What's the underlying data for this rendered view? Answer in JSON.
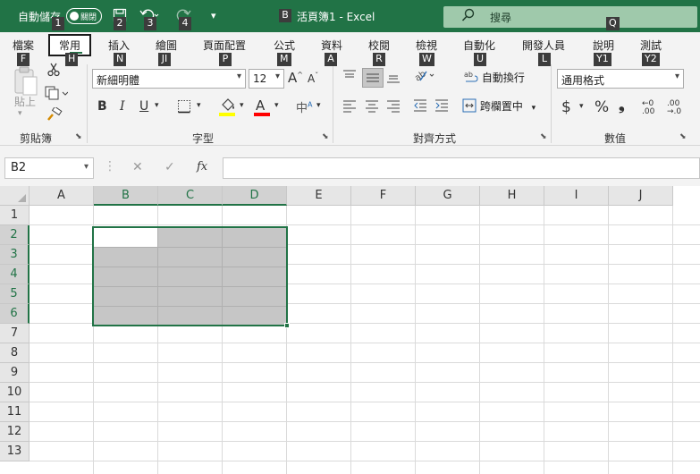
{
  "titlebar": {
    "autosave_label": "自動儲存",
    "autosave_state": "關閉",
    "document_title": "活頁簿1 - Excel",
    "search_placeholder": "搜尋",
    "qat_more": "▾"
  },
  "keytips": {
    "autosave": "1",
    "save": "2",
    "undo": "3",
    "redo": "4",
    "title": "B",
    "search": "Q",
    "file": "F",
    "home": "H",
    "insert": "N",
    "draw": "JI",
    "layout": "P",
    "formulas": "M",
    "data": "A",
    "review": "R",
    "view": "W",
    "automate": "U",
    "developer": "L",
    "help": "Y1",
    "test": "Y2"
  },
  "tabs": [
    {
      "label": "檔案"
    },
    {
      "label": "常用"
    },
    {
      "label": "插入"
    },
    {
      "label": "繪圖"
    },
    {
      "label": "頁面配置"
    },
    {
      "label": "公式"
    },
    {
      "label": "資料"
    },
    {
      "label": "校閱"
    },
    {
      "label": "檢視"
    },
    {
      "label": "自動化"
    },
    {
      "label": "開發人員"
    },
    {
      "label": "說明"
    },
    {
      "label": "測試"
    }
  ],
  "ribbon": {
    "clipboard": {
      "label": "剪貼簿",
      "paste_label": "貼上"
    },
    "font": {
      "label": "字型",
      "font_name": "新細明體",
      "font_size": "12",
      "bold": "B",
      "italic": "I",
      "underline": "U",
      "highlight_color": "#ffff00",
      "font_color": "#ff0000"
    },
    "alignment": {
      "label": "對齊方式",
      "wrap_text": "自動換行",
      "merge_center": "跨欄置中"
    },
    "number": {
      "label": "數值",
      "format": "通用格式",
      "currency": "$",
      "percent": "%",
      "comma": "❟"
    }
  },
  "formula_bar": {
    "name_box": "B2",
    "cancel": "✕",
    "enter": "✓",
    "fx": "fx",
    "content": ""
  },
  "grid": {
    "columns": [
      "A",
      "B",
      "C",
      "D",
      "E",
      "F",
      "G",
      "H",
      "I",
      "J"
    ],
    "rows": [
      "1",
      "2",
      "3",
      "4",
      "5",
      "6",
      "7",
      "8",
      "9",
      "10",
      "11",
      "12",
      "13"
    ],
    "selected_range": "B2:D6",
    "active_cell": "B2"
  },
  "colors": {
    "accent": "#217346",
    "selection_fill": "#c6c6c6",
    "search_fill": "#9fc9ab"
  }
}
